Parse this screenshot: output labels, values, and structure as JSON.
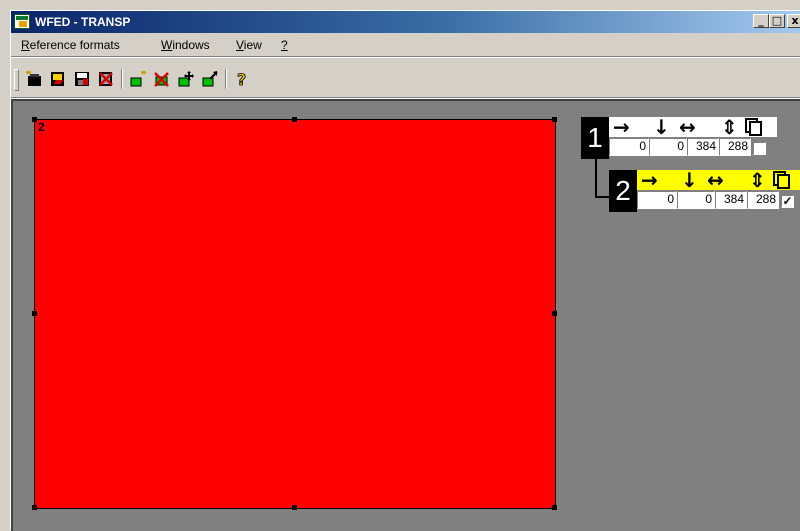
{
  "window": {
    "title": "WFED - TRANSP",
    "min_label": "_",
    "max_label": "□",
    "close_label": "x"
  },
  "menu": {
    "items": [
      {
        "underline": "R",
        "rest": "eference formats"
      },
      {
        "underline": "W",
        "rest": "indows"
      },
      {
        "underline": "V",
        "rest": "iew"
      },
      {
        "underline": "?",
        "rest": ""
      }
    ]
  },
  "toolbar": {
    "icons": [
      "new-format-icon",
      "open-format-icon",
      "save-format-icon",
      "delete-format-icon",
      "new-window-icon",
      "delete-window-icon",
      "move-window-icon",
      "resize-window-icon",
      "help-icon"
    ]
  },
  "canvas": {
    "label": "2",
    "color": "#ff0000"
  },
  "layers": [
    {
      "number": "1",
      "header_bg": "#ffffff",
      "x": "0",
      "y": "0",
      "width": "384",
      "height": "288",
      "checked": false,
      "check_mark": ""
    },
    {
      "number": "2",
      "header_bg": "#ffff00",
      "x": "0",
      "y": "0",
      "width": "384",
      "height": "288",
      "checked": true,
      "check_mark": "✓"
    }
  ],
  "layer_header": {
    "x_icon": "→",
    "y_icon": "↓",
    "width_icon": "↔",
    "height_icon": "⇕"
  }
}
